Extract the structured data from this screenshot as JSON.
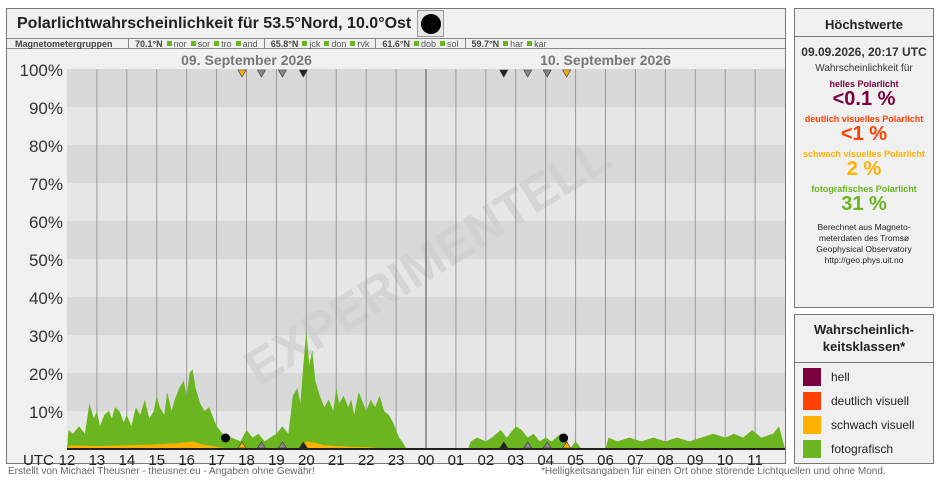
{
  "title": "Polarlichtwahrscheinlichkeit für 53.5°Nord, 10.0°Ost",
  "moon_icon": "moon-phase-icon",
  "magnetometer": {
    "label": "Magnetometergruppen",
    "groups": [
      {
        "lat": "70.1°N",
        "stations": [
          "nor",
          "sor",
          "tro",
          "and"
        ]
      },
      {
        "lat": "65.8°N",
        "stations": [
          "jck",
          "don",
          "rvk"
        ]
      },
      {
        "lat": "61.6°N",
        "stations": [
          "dob",
          "sol"
        ]
      },
      {
        "lat": "59.7°N",
        "stations": [
          "har",
          "kar"
        ]
      }
    ]
  },
  "max_panel": {
    "header": "Höchstwerte",
    "datetime": "09.09.2026, 20:17 UTC",
    "prob_label": "Wahrscheinlichkeit für",
    "classes": [
      {
        "label": "helles Polarlicht",
        "value": "<0.1 %",
        "color": "#7a0040"
      },
      {
        "label": "deutlich visuelles Polarlicht",
        "value": "<1 %",
        "color": "#ff4000"
      },
      {
        "label": "schwach visuelles Polarlicht",
        "value": "2 %",
        "color": "#ffb000"
      },
      {
        "label": "fotografisches Polarlicht",
        "value": "31 %",
        "color": "#6ab520"
      }
    ],
    "source_lines": [
      "Berechnet aus Magneto-",
      "meterdaten des Tromsø",
      "Geophysical Observatory",
      "http://geo.phys.uit.no"
    ]
  },
  "legend_panel": {
    "header_lines": [
      "Wahrscheinlich-",
      "keitsklassen*"
    ],
    "items": [
      {
        "label": "hell",
        "color": "#7a0040"
      },
      {
        "label": "deutlich visuell",
        "color": "#ff4000"
      },
      {
        "label": "schwach visuell",
        "color": "#ffb000"
      },
      {
        "label": "fotografisch",
        "color": "#6ab520"
      }
    ]
  },
  "footer_left": "Erstellt von Michael Theusner - theusner.eu - Angaben ohne Gewähr!",
  "footer_right": "*Helligkeitsangaben für einen Ort ohne störende Lichtquellen und ohne Mond.",
  "chart_data": {
    "type": "area",
    "watermark": "EXPERIMENTELL",
    "dates": [
      "09. September 2026",
      "10. September 2026"
    ],
    "x_unit_label": "UTC",
    "x_ticks": [
      "12",
      "13",
      "14",
      "15",
      "16",
      "17",
      "18",
      "19",
      "20",
      "21",
      "22",
      "23",
      "00",
      "01",
      "02",
      "03",
      "04",
      "05",
      "06",
      "07",
      "08",
      "09",
      "10",
      "11"
    ],
    "y_ticks": [
      "100%",
      "90%",
      "80%",
      "70%",
      "60%",
      "50%",
      "40%",
      "30%",
      "20%",
      "10%"
    ],
    "ylim": [
      0,
      100
    ],
    "grid": true,
    "start_hour": 12,
    "duration_hours": 24,
    "series": [
      {
        "name": "fotografisch",
        "color": "#6ab520",
        "points": [
          [
            12.0,
            0
          ],
          [
            12.05,
            5
          ],
          [
            12.2,
            4
          ],
          [
            12.4,
            6
          ],
          [
            12.6,
            4
          ],
          [
            12.75,
            12
          ],
          [
            12.9,
            8
          ],
          [
            13.0,
            10
          ],
          [
            13.1,
            6
          ],
          [
            13.25,
            9
          ],
          [
            13.4,
            10
          ],
          [
            13.5,
            8
          ],
          [
            13.6,
            11
          ],
          [
            13.75,
            10
          ],
          [
            13.9,
            7
          ],
          [
            14.0,
            9
          ],
          [
            14.15,
            6
          ],
          [
            14.3,
            11
          ],
          [
            14.45,
            9
          ],
          [
            14.6,
            13
          ],
          [
            14.75,
            8
          ],
          [
            14.9,
            10
          ],
          [
            15.0,
            14
          ],
          [
            15.1,
            11
          ],
          [
            15.25,
            9
          ],
          [
            15.35,
            15
          ],
          [
            15.5,
            10
          ],
          [
            15.6,
            13
          ],
          [
            15.75,
            16
          ],
          [
            15.9,
            18
          ],
          [
            16.0,
            14
          ],
          [
            16.1,
            20
          ],
          [
            16.2,
            21
          ],
          [
            16.3,
            16
          ],
          [
            16.45,
            12
          ],
          [
            16.6,
            10
          ],
          [
            16.75,
            11
          ],
          [
            16.9,
            8
          ],
          [
            17.0,
            6
          ],
          [
            17.2,
            4
          ],
          [
            17.5,
            3
          ],
          [
            17.8,
            2
          ],
          [
            18.0,
            5
          ],
          [
            18.2,
            3
          ],
          [
            18.4,
            4
          ],
          [
            18.6,
            2
          ],
          [
            18.8,
            3
          ],
          [
            19.0,
            4
          ],
          [
            19.2,
            6
          ],
          [
            19.4,
            4
          ],
          [
            19.55,
            14
          ],
          [
            19.7,
            16
          ],
          [
            19.8,
            12
          ],
          [
            19.9,
            22
          ],
          [
            20.0,
            31
          ],
          [
            20.1,
            22
          ],
          [
            20.2,
            26
          ],
          [
            20.3,
            18
          ],
          [
            20.45,
            14
          ],
          [
            20.6,
            11
          ],
          [
            20.75,
            13
          ],
          [
            20.9,
            10
          ],
          [
            21.0,
            16
          ],
          [
            21.1,
            12
          ],
          [
            21.25,
            14
          ],
          [
            21.4,
            11
          ],
          [
            21.5,
            13
          ],
          [
            21.6,
            9
          ],
          [
            21.75,
            15
          ],
          [
            21.9,
            12
          ],
          [
            22.0,
            10
          ],
          [
            22.15,
            13
          ],
          [
            22.3,
            11
          ],
          [
            22.45,
            14
          ],
          [
            22.6,
            10
          ],
          [
            22.75,
            9
          ],
          [
            22.9,
            7
          ],
          [
            23.0,
            5
          ],
          [
            23.1,
            3
          ],
          [
            23.2,
            2
          ],
          [
            23.35,
            0
          ],
          [
            24.0,
            0
          ],
          [
            25.4,
            0
          ],
          [
            25.5,
            2
          ],
          [
            25.7,
            3
          ],
          [
            26.0,
            2
          ],
          [
            26.2,
            3
          ],
          [
            26.5,
            5
          ],
          [
            26.7,
            3
          ],
          [
            27.0,
            6
          ],
          [
            27.2,
            5
          ],
          [
            27.4,
            3
          ],
          [
            27.6,
            4
          ],
          [
            27.8,
            2
          ],
          [
            28.0,
            3
          ],
          [
            28.2,
            2
          ],
          [
            28.5,
            4
          ],
          [
            28.7,
            3
          ],
          [
            28.8,
            0
          ],
          [
            29.0,
            2
          ],
          [
            29.2,
            0
          ],
          [
            30.0,
            0
          ],
          [
            30.1,
            3
          ],
          [
            30.4,
            2
          ],
          [
            30.8,
            3
          ],
          [
            31.2,
            2
          ],
          [
            31.6,
            3
          ],
          [
            32.0,
            2
          ],
          [
            32.4,
            3
          ],
          [
            32.8,
            2
          ],
          [
            33.2,
            3
          ],
          [
            33.6,
            4
          ],
          [
            34.0,
            3
          ],
          [
            34.3,
            4
          ],
          [
            34.6,
            3
          ],
          [
            34.9,
            5
          ],
          [
            35.2,
            3
          ],
          [
            35.6,
            4
          ],
          [
            35.8,
            6
          ],
          [
            36.0,
            0
          ]
        ]
      },
      {
        "name": "schwach visuell",
        "color": "#ffb000",
        "points": [
          [
            12.0,
            0
          ],
          [
            12.1,
            1
          ],
          [
            13.0,
            0.8
          ],
          [
            14.0,
            1
          ],
          [
            15.0,
            1.2
          ],
          [
            15.8,
            1.6
          ],
          [
            16.2,
            2
          ],
          [
            16.5,
            1.2
          ],
          [
            17.0,
            0.6
          ],
          [
            17.5,
            0
          ],
          [
            19.8,
            0
          ],
          [
            19.9,
            1.4
          ],
          [
            20.0,
            2
          ],
          [
            20.3,
            1.6
          ],
          [
            20.6,
            1
          ],
          [
            21.0,
            0.8
          ],
          [
            21.5,
            0.6
          ],
          [
            22.0,
            0.5
          ],
          [
            23.0,
            0
          ],
          [
            36.0,
            0
          ]
        ]
      }
    ],
    "markers": [
      {
        "hour": 17.85,
        "color": "#ffb000"
      },
      {
        "hour": 18.5,
        "color": "#888888"
      },
      {
        "hour": 19.2,
        "color": "#888888"
      },
      {
        "hour": 19.9,
        "color": "#222222"
      },
      {
        "hour": 26.6,
        "color": "#222222"
      },
      {
        "hour": 27.4,
        "color": "#888888"
      },
      {
        "hour": 28.05,
        "color": "#888888"
      },
      {
        "hour": 28.7,
        "color": "#ffb000"
      }
    ]
  }
}
